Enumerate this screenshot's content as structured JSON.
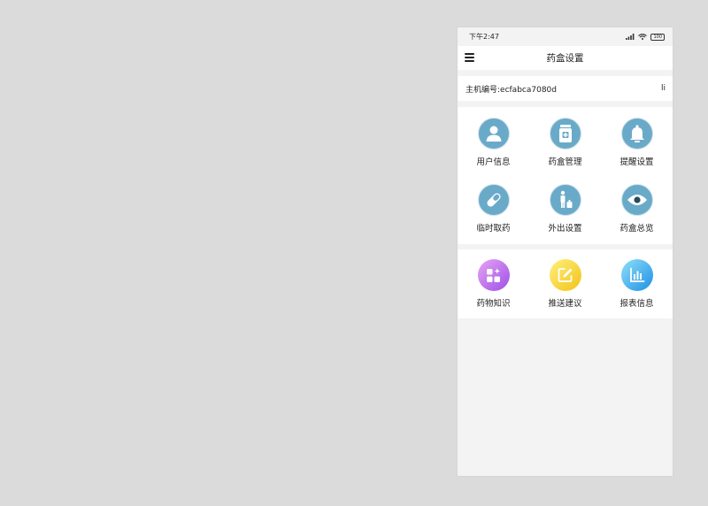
{
  "status": {
    "time": "下午2:47",
    "battery": "100"
  },
  "header": {
    "title": "药盒设置"
  },
  "host": {
    "label": "主机编号:ecfabca7080d",
    "right_text": "li"
  },
  "grid1": [
    {
      "label": "用户信息",
      "icon": "user-icon"
    },
    {
      "label": "药盒管理",
      "icon": "pill-bottle-icon"
    },
    {
      "label": "提醒设置",
      "icon": "bell-icon"
    },
    {
      "label": "临时取药",
      "icon": "capsule-icon"
    },
    {
      "label": "外出设置",
      "icon": "person-luggage-icon"
    },
    {
      "label": "药盒总览",
      "icon": "eye-icon"
    }
  ],
  "grid2": [
    {
      "label": "药物知识",
      "icon": "apps-sparkle-icon"
    },
    {
      "label": "推送建议",
      "icon": "edit-icon"
    },
    {
      "label": "报表信息",
      "icon": "bar-chart-icon"
    }
  ],
  "colors": {
    "page_bg": "#dbdbdb",
    "app_bg": "#f3f3f3",
    "icon_blue": "#6aaac9",
    "purple_gradient": [
      "#e6a4f5",
      "#9e4fe6"
    ],
    "yellow_gradient": [
      "#fff07a",
      "#f2c21a"
    ],
    "blue_gradient": [
      "#8fe0f7",
      "#1e8fe6"
    ]
  }
}
